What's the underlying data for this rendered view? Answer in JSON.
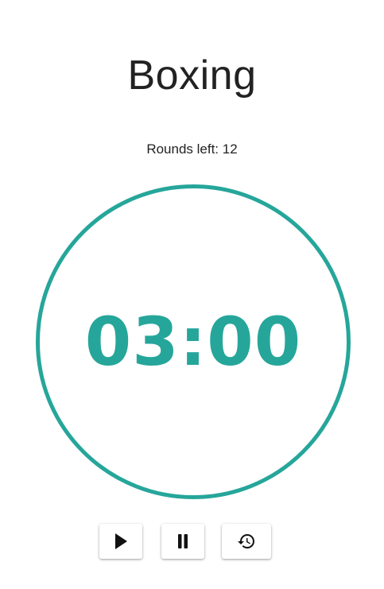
{
  "app": {
    "title": "Boxing"
  },
  "rounds": {
    "text": "Rounds left: 12"
  },
  "timer": {
    "display": "03:00"
  },
  "controls": {
    "play_icon": "play-icon",
    "pause_icon": "pause-icon",
    "reset_icon": "history-reset-icon"
  },
  "colors": {
    "accent": "#26a69a",
    "text": "#222222",
    "background": "#ffffff"
  }
}
